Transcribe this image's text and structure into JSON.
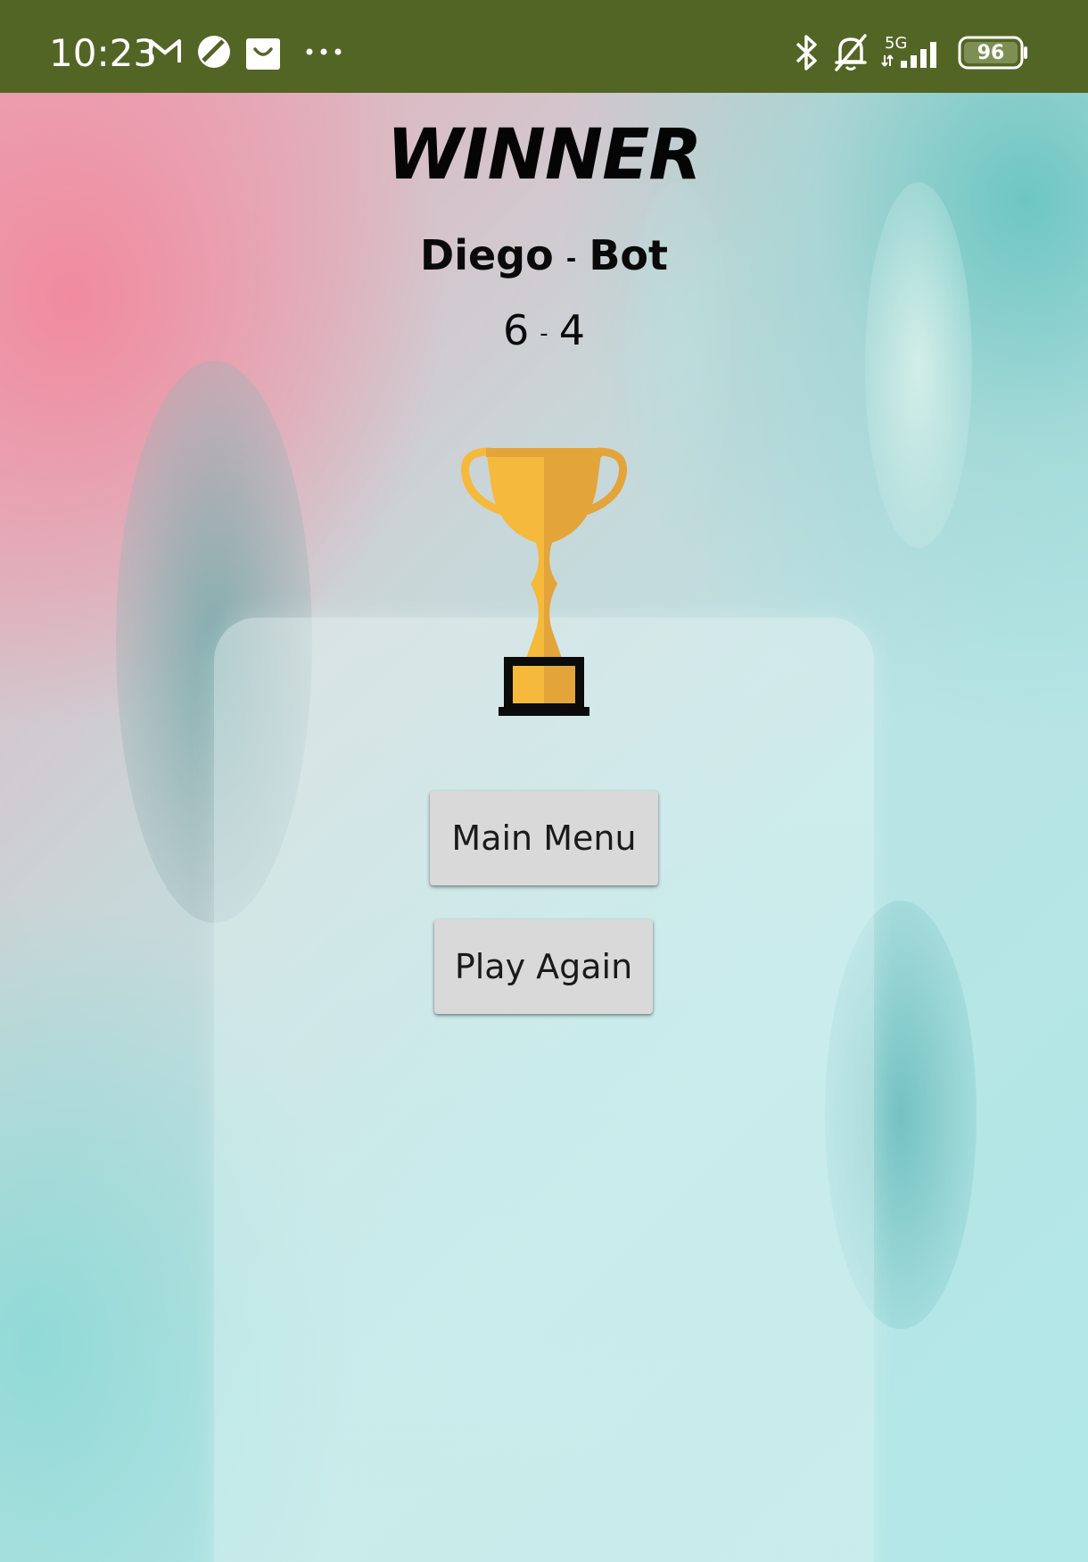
{
  "status_bar": {
    "time": "10:23",
    "network": "5G",
    "battery": "96",
    "background": "#536524"
  },
  "result": {
    "title": "WINNER",
    "player_one": "Diego",
    "player_two": "Bot",
    "separator": "-",
    "score_one": "6",
    "score_two": "4"
  },
  "buttons": {
    "main_menu": "Main Menu",
    "play_again": "Play Again"
  },
  "icons": {
    "trophy": "trophy-icon",
    "gmail": "gmail-icon",
    "bluetooth": "bluetooth-icon",
    "mute": "notifications-off-icon"
  },
  "colors": {
    "trophy_gold": "#F5B93C",
    "trophy_shade": "#E3A43A",
    "button_bg": "#D9D9D9"
  }
}
